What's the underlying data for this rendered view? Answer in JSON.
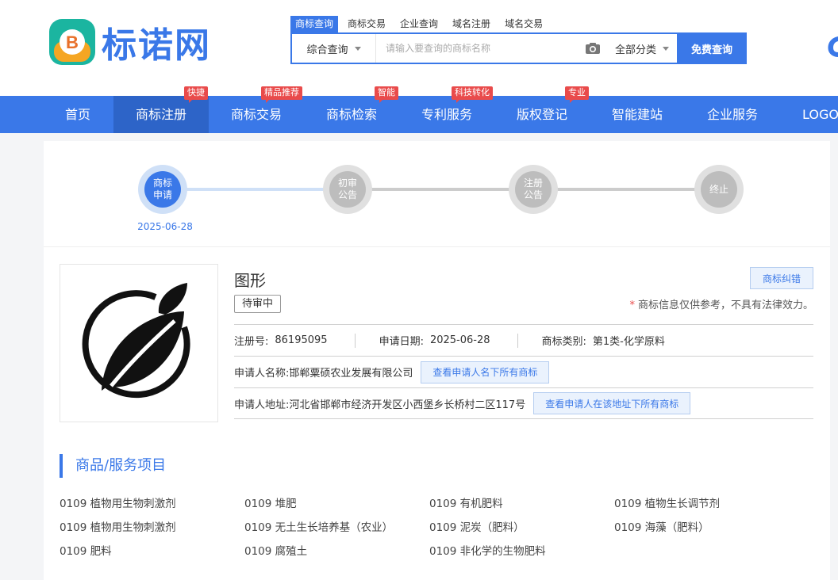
{
  "header": {
    "logo_text": "标诺网",
    "search_tabs": [
      "商标查询",
      "商标交易",
      "企业查询",
      "域名注册",
      "域名交易"
    ],
    "search_scope": "综合查询",
    "search_placeholder": "请输入要查询的商标名称",
    "search_category": "全部分类",
    "search_button": "免费查询"
  },
  "nav": {
    "items": [
      {
        "label": "首页",
        "badge": ""
      },
      {
        "label": "商标注册",
        "badge": "快捷"
      },
      {
        "label": "商标交易",
        "badge": "精品推荐"
      },
      {
        "label": "商标检索",
        "badge": "智能"
      },
      {
        "label": "专利服务",
        "badge": "科技转化"
      },
      {
        "label": "版权登记",
        "badge": "专业"
      },
      {
        "label": "智能建站",
        "badge": ""
      },
      {
        "label": "企业服务",
        "badge": ""
      },
      {
        "label": "LOGO",
        "badge": ""
      }
    ]
  },
  "progress": {
    "steps": [
      "商标\n申请",
      "初审\n公告",
      "注册\n公告",
      "终止"
    ],
    "active_step": 0,
    "date": "2025-06-28"
  },
  "trademark": {
    "name": "图形",
    "status": "待审中",
    "correct_button": "商标纠错",
    "disclaimer": "商标信息仅供参考，不具有法律效力。",
    "reg_no_label": "注册号:",
    "reg_no": "86195095",
    "apply_date_label": "申请日期:",
    "apply_date": "2025-06-28",
    "class_label": "商标类别:",
    "class": "第1类-化学原料",
    "applicant_label": "申请人名称:",
    "applicant": "邯郸粟硕农业发展有限公司",
    "applicant_button": "查看申请人名下所有商标",
    "address_label": "申请人地址:",
    "address": "河北省邯郸市经济开发区小西堡乡长桥村二区117号",
    "address_button": "查看申请人在该地址下所有商标"
  },
  "goods": {
    "title": "商品/服务项目",
    "items": [
      "0109 植物用生物刺激剂",
      "0109 堆肥",
      "0109 有机肥料",
      "0109 植物生长调节剂",
      "0109 植物用生物刺激剂",
      "0109 无土生长培养基（农业）",
      "0109 泥炭（肥料）",
      "0109 海藻（肥料）",
      "0109 肥料",
      "0109 腐殖土",
      "0109 非化学的生物肥料"
    ]
  },
  "colors": {
    "accent": "#3a78e8",
    "badge": "#e94b4b",
    "nav_active": "#2d64c8"
  }
}
